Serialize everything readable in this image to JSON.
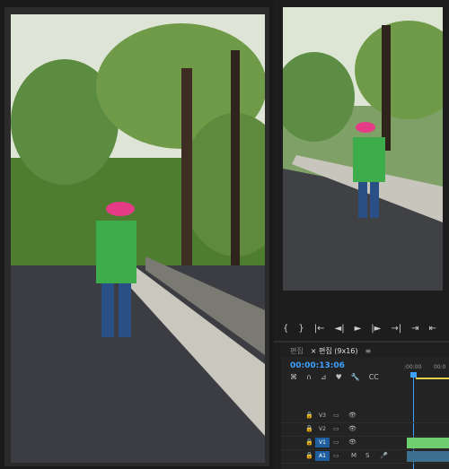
{
  "left_preview": {
    "type": "video-frame"
  },
  "right_preview": {
    "type": "video-frame"
  },
  "transport_controls": [
    "{",
    "}",
    "|←",
    "◄|",
    "►",
    "|►",
    "→|",
    "⇥",
    "⇤"
  ],
  "timeline": {
    "tabs": [
      {
        "label": "편집",
        "active": false
      },
      {
        "label": "× 편집 (9x16)",
        "active": true
      }
    ],
    "tab_menu": "≡",
    "timecode": "00:00:13:06",
    "ruler_labels": [
      ":00:00",
      "00:0"
    ],
    "tools": [
      "⌘",
      "∩",
      "⊿",
      "♥",
      "🔧",
      "CC"
    ],
    "tracks": [
      {
        "name": "V3",
        "selected": false
      },
      {
        "name": "V2",
        "selected": false
      },
      {
        "name": "V1",
        "selected": true,
        "has_clip": true
      },
      {
        "name": "A1",
        "selected": true,
        "has_audio": true
      }
    ]
  }
}
